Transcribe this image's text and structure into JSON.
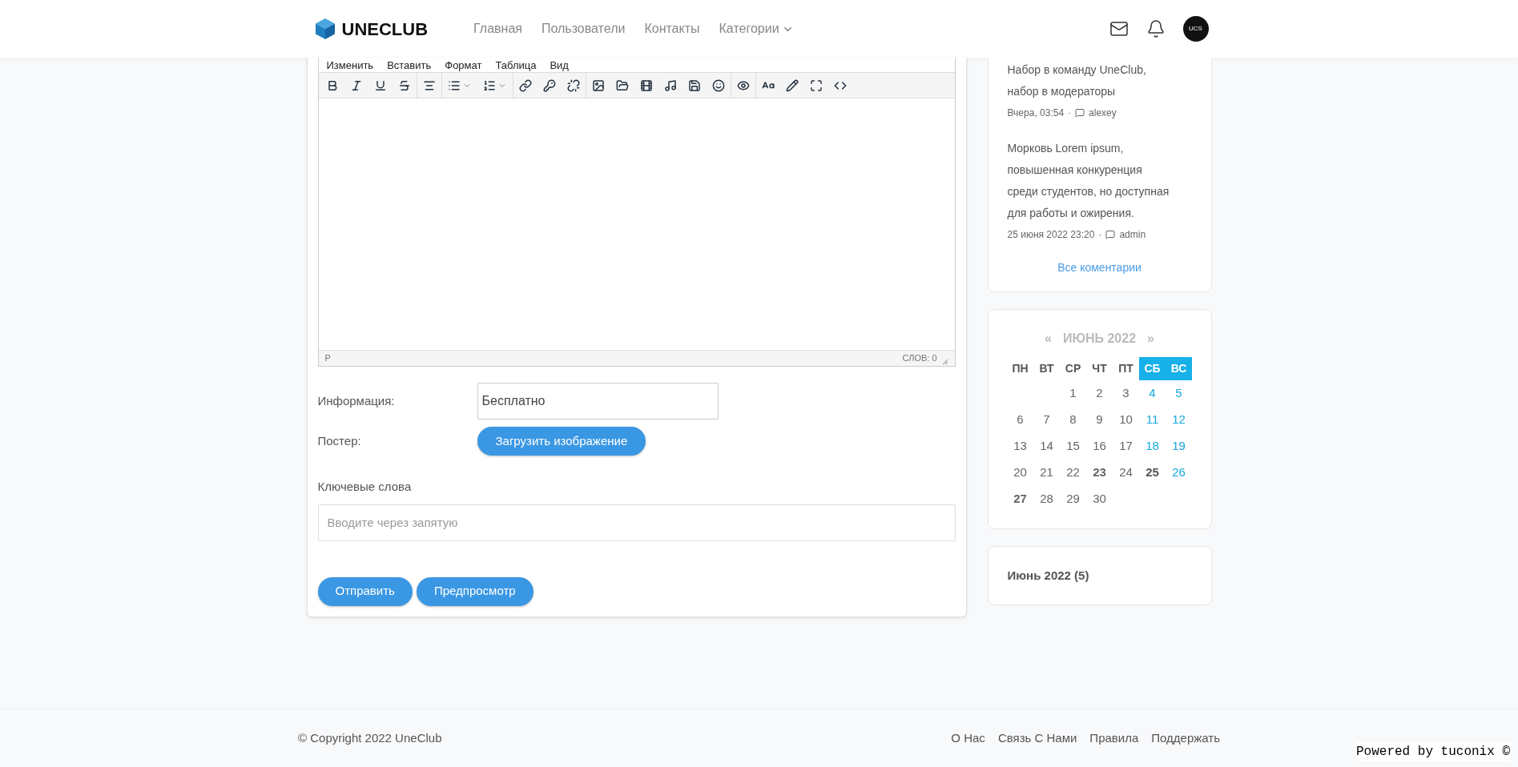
{
  "header": {
    "brand": "UNECLUB",
    "nav": [
      {
        "label": "Главная",
        "dropdown": false
      },
      {
        "label": "Пользователи",
        "dropdown": false
      },
      {
        "label": "Контакты",
        "dropdown": false
      },
      {
        "label": "Категории",
        "dropdown": true
      }
    ],
    "avatar": "UCS"
  },
  "editor": {
    "menu": [
      "Изменить",
      "Вставить",
      "Формат",
      "Таблица",
      "Вид"
    ],
    "path": "P",
    "word_count": "СЛОВ: 0"
  },
  "form": {
    "info_label": "Информация:",
    "info_value": "Бесплатно",
    "poster_label": "Постер:",
    "upload_button": "Загрузить изображение",
    "keywords_label": "Ключевые слова",
    "keywords_placeholder": "Вводите через запятую",
    "buttons": [
      "Отправить",
      "Предпросмотр"
    ]
  },
  "comments": {
    "items": [
      {
        "text": "Набор в команду UneClub, набор в модераторы",
        "date": "Вчера, 03:54",
        "separator": "·",
        "author": "alexey"
      },
      {
        "text": "Морковь Lorem ipsum, повышенная конкуренция среди студентов, но доступная для работы и ожирения.",
        "date": "25 июня 2022 23:20",
        "separator": "·",
        "author": "admin"
      }
    ],
    "all_link": "Все коментарии"
  },
  "calendar": {
    "prev": "«",
    "title": "ИЮНЬ 2022",
    "next": "»",
    "weekdays": [
      {
        "label": "ПН",
        "weekend": false
      },
      {
        "label": "ВТ",
        "weekend": false
      },
      {
        "label": "СР",
        "weekend": false
      },
      {
        "label": "ЧТ",
        "weekend": false
      },
      {
        "label": "ПТ",
        "weekend": false
      },
      {
        "label": "СБ",
        "weekend": true
      },
      {
        "label": "ВС",
        "weekend": true
      }
    ],
    "weeks": [
      [
        {
          "kind": "empty"
        },
        {
          "kind": "empty"
        },
        {
          "kind": "day",
          "day": "1",
          "weekend": false,
          "has_posts": false
        },
        {
          "kind": "day",
          "day": "2",
          "weekend": false,
          "has_posts": false
        },
        {
          "kind": "day",
          "day": "3",
          "weekend": false,
          "has_posts": false
        },
        {
          "kind": "day",
          "day": "4",
          "weekend": true,
          "has_posts": false
        },
        {
          "kind": "day",
          "day": "5",
          "weekend": true,
          "has_posts": false
        }
      ],
      [
        {
          "kind": "day",
          "day": "6",
          "weekend": false,
          "has_posts": false
        },
        {
          "kind": "day",
          "day": "7",
          "weekend": false,
          "has_posts": false
        },
        {
          "kind": "day",
          "day": "8",
          "weekend": false,
          "has_posts": false
        },
        {
          "kind": "day",
          "day": "9",
          "weekend": false,
          "has_posts": false
        },
        {
          "kind": "day",
          "day": "10",
          "weekend": false,
          "has_posts": false
        },
        {
          "kind": "day",
          "day": "11",
          "weekend": true,
          "has_posts": false
        },
        {
          "kind": "day",
          "day": "12",
          "weekend": true,
          "has_posts": false
        }
      ],
      [
        {
          "kind": "day",
          "day": "13",
          "weekend": false,
          "has_posts": false
        },
        {
          "kind": "day",
          "day": "14",
          "weekend": false,
          "has_posts": false
        },
        {
          "kind": "day",
          "day": "15",
          "weekend": false,
          "has_posts": false
        },
        {
          "kind": "day",
          "day": "16",
          "weekend": false,
          "has_posts": false
        },
        {
          "kind": "day",
          "day": "17",
          "weekend": false,
          "has_posts": false
        },
        {
          "kind": "day",
          "day": "18",
          "weekend": true,
          "has_posts": false
        },
        {
          "kind": "day",
          "day": "19",
          "weekend": true,
          "has_posts": false
        }
      ],
      [
        {
          "kind": "day",
          "day": "20",
          "weekend": false,
          "has_posts": false
        },
        {
          "kind": "day",
          "day": "21",
          "weekend": false,
          "has_posts": false
        },
        {
          "kind": "day",
          "day": "22",
          "weekend": false,
          "has_posts": false
        },
        {
          "kind": "day",
          "day": "23",
          "weekend": false,
          "has_posts": true
        },
        {
          "kind": "day",
          "day": "24",
          "weekend": false,
          "has_posts": false
        },
        {
          "kind": "day",
          "day": "25",
          "weekend": true,
          "has_posts": true
        },
        {
          "kind": "day",
          "day": "26",
          "weekend": true,
          "has_posts": false
        }
      ],
      [
        {
          "kind": "day",
          "day": "27",
          "weekend": false,
          "has_posts": true
        },
        {
          "kind": "day",
          "day": "28",
          "weekend": false,
          "has_posts": false
        },
        {
          "kind": "day",
          "day": "29",
          "weekend": false,
          "has_posts": false
        },
        {
          "kind": "day",
          "day": "30",
          "weekend": false,
          "has_posts": false
        },
        {
          "kind": "empty"
        },
        {
          "kind": "empty"
        },
        {
          "kind": "empty"
        }
      ]
    ]
  },
  "archive": {
    "label": "Июнь 2022 (5)"
  },
  "footer": {
    "copyright": "© Copyright 2022 UneClub",
    "links": [
      "О Нас",
      "Связь С Нами",
      "Правила",
      "Поддержать"
    ]
  },
  "powered_by": "Powered by tuconix ©"
}
